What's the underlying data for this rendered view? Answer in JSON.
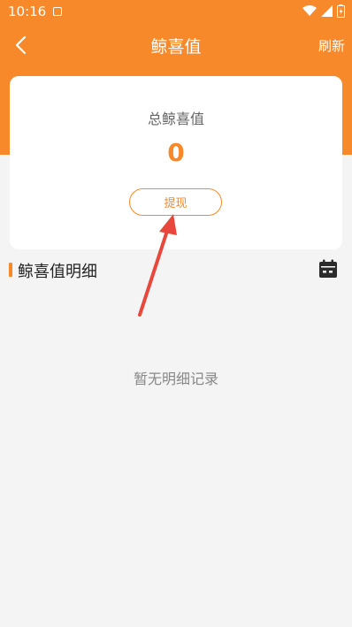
{
  "status_bar": {
    "time": "10:16"
  },
  "nav": {
    "title": "鲸喜值",
    "refresh_label": "刷新"
  },
  "summary": {
    "label": "总鲸喜值",
    "value": "0",
    "withdraw_label": "提现"
  },
  "details": {
    "title": "鲸喜值明细",
    "empty_text": "暂无明细记录"
  },
  "colors": {
    "accent": "#f8892a",
    "background": "#f4f4f4",
    "annotation": "#e8473c"
  },
  "icons": {
    "back": "chevron-left-icon",
    "calendar": "calendar-icon",
    "wifi": "wifi-icon",
    "signal": "signal-icon",
    "battery": "battery-icon"
  }
}
